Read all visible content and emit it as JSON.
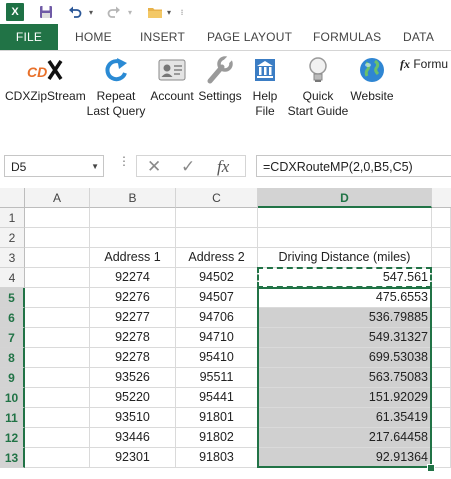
{
  "quick_access": {
    "logo_letter": "X",
    "icons": [
      "excel-logo-icon",
      "save-icon",
      "undo-icon",
      "redo-icon",
      "open-folder-icon"
    ]
  },
  "tabs": [
    "FILE",
    "HOME",
    "INSERT",
    "PAGE LAYOUT",
    "FORMULAS",
    "DATA"
  ],
  "ribbon": {
    "buttons": [
      {
        "label1": "CDXZipStream",
        "label2": "",
        "icon": "cdx-logo-icon"
      },
      {
        "label1": "Repeat",
        "label2": "Last Query",
        "icon": "refresh-icon"
      },
      {
        "label1": "Account",
        "label2": "",
        "icon": "account-card-icon"
      },
      {
        "label1": "Settings",
        "label2": "",
        "icon": "wrench-icon"
      },
      {
        "label1": "Help",
        "label2": "File",
        "icon": "help-book-icon"
      },
      {
        "label1": "Quick",
        "label2": "Start Guide",
        "icon": "lightbulb-icon"
      },
      {
        "label1": "Website",
        "label2": "",
        "icon": "globe-icon"
      }
    ],
    "formula_fx": "fx",
    "formula_label": "Formu"
  },
  "formula_bar": {
    "name_box": "D5",
    "fx": "fx",
    "formula": "=CDXRouteMP(2,0,B5,C5)"
  },
  "sheet": {
    "columns": [
      "A",
      "B",
      "C",
      "D"
    ],
    "selected_column": "D",
    "rows": [
      {
        "n": "1",
        "b": "",
        "c": "",
        "d": ""
      },
      {
        "n": "2",
        "b": "",
        "c": "",
        "d": ""
      },
      {
        "n": "3",
        "b": "Address 1",
        "c": "Address 2",
        "d": "Driving Distance (miles)"
      },
      {
        "n": "4",
        "b": "92274",
        "c": "94502",
        "d": "547.561"
      },
      {
        "n": "5",
        "b": "92276",
        "c": "94507",
        "d": "475.6553"
      },
      {
        "n": "6",
        "b": "92277",
        "c": "94706",
        "d": "536.79885"
      },
      {
        "n": "7",
        "b": "92278",
        "c": "94710",
        "d": "549.31327"
      },
      {
        "n": "8",
        "b": "92278",
        "c": "95410",
        "d": "699.53038"
      },
      {
        "n": "9",
        "b": "93526",
        "c": "95511",
        "d": "563.75083"
      },
      {
        "n": "10",
        "b": "95220",
        "c": "95441",
        "d": "151.92029"
      },
      {
        "n": "11",
        "b": "93510",
        "c": "91801",
        "d": "61.35419"
      },
      {
        "n": "12",
        "b": "93446",
        "c": "91802",
        "d": "217.64458"
      },
      {
        "n": "13",
        "b": "92301",
        "c": "91803",
        "d": "92.91364"
      }
    ],
    "active_cell": "D5",
    "selection": "D5:D13",
    "copy_marquee": "D4",
    "accent_color": "#217346"
  }
}
